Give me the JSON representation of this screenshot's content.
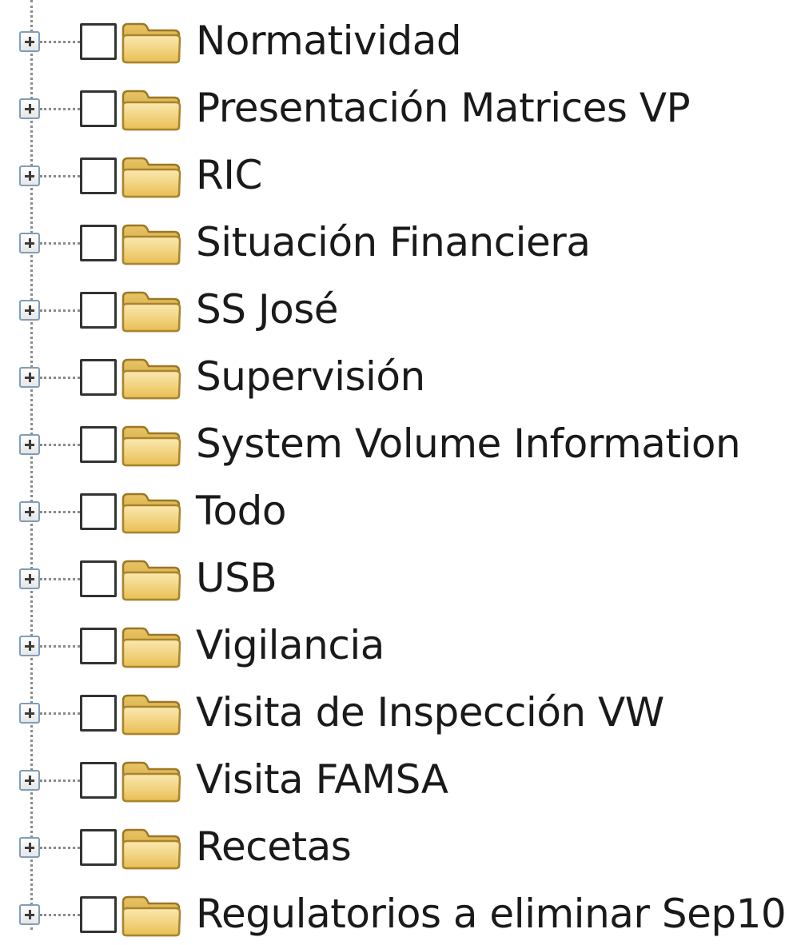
{
  "tree": {
    "items": [
      {
        "label": "Normatividad",
        "expander": "plus-box-icon",
        "folder_icon": "folder-icon"
      },
      {
        "label": "Presentación Matrices VP",
        "expander": "plus-box-icon",
        "folder_icon": "folder-icon"
      },
      {
        "label": "RIC",
        "expander": "plus-box-icon",
        "folder_icon": "folder-icon"
      },
      {
        "label": "Situación Financiera",
        "expander": "plus-box-icon",
        "folder_icon": "folder-icon"
      },
      {
        "label": "SS José",
        "expander": "plus-box-icon",
        "folder_icon": "folder-icon"
      },
      {
        "label": "Supervisión",
        "expander": "plus-box-icon",
        "folder_icon": "folder-icon"
      },
      {
        "label": "System Volume Information",
        "expander": "plus-box-icon",
        "folder_icon": "folder-icon"
      },
      {
        "label": "Todo",
        "expander": "plus-box-icon",
        "folder_icon": "folder-icon"
      },
      {
        "label": "USB",
        "expander": "plus-box-icon",
        "folder_icon": "folder-icon"
      },
      {
        "label": "Vigilancia",
        "expander": "plus-box-icon",
        "folder_icon": "folder-icon"
      },
      {
        "label": "Visita de Inspección VW",
        "expander": "plus-box-icon",
        "folder_icon": "folder-icon"
      },
      {
        "label": "Visita FAMSA",
        "expander": "plus-box-icon",
        "folder_icon": "folder-icon"
      },
      {
        "label": "Recetas",
        "expander": "plus-box-icon",
        "folder_icon": "folder-icon"
      },
      {
        "label": "Regulatorios a eliminar Sep10",
        "expander": "plus-box-icon",
        "folder_icon": "folder-icon"
      }
    ]
  },
  "colors": {
    "folder_fill": "#f5d98a",
    "folder_edge": "#b08a2e",
    "expander_border": "#7f9db9",
    "text": "#1a1a1a"
  }
}
